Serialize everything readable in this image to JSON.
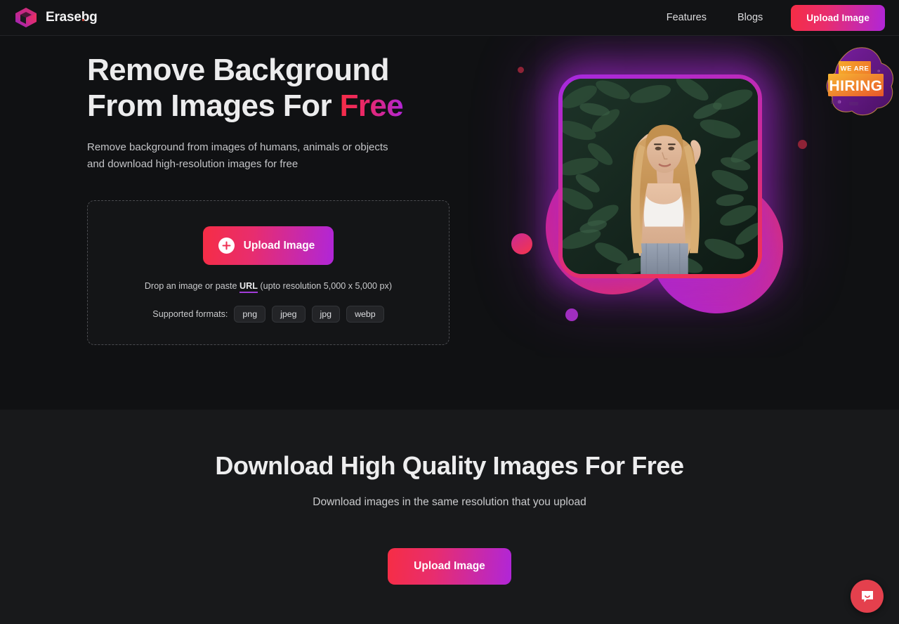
{
  "header": {
    "brand": {
      "name": "Erase",
      "dot": ".",
      "suffix": "bg",
      "icon": "erasebg-cube-logo"
    },
    "nav": [
      {
        "label": "Features",
        "name": "nav-features"
      },
      {
        "label": "Blogs",
        "name": "nav-blogs"
      }
    ],
    "upload_button": "Upload Image"
  },
  "hero": {
    "title_line1": "Remove Background",
    "title_line2_prefix": "From Images For ",
    "title_highlight": "Free",
    "subtitle_line1": "Remove background from images of humans, animals or objects",
    "subtitle_line2": "and download high-resolution images for free",
    "dropzone": {
      "upload_button": "Upload Image",
      "plus_icon": "plus-icon",
      "hint_prefix": "Drop an image or paste ",
      "hint_url": "URL",
      "hint_suffix": " (upto resolution 5,000 x 5,000 px)",
      "formats_label": "Supported formats:",
      "formats": [
        "png",
        "jpeg",
        "jpg",
        "webp"
      ]
    },
    "art": {
      "image_alt": "woman with long wavy blonde hair in white crop top against dark green leaves",
      "badge": {
        "line1": "WE ARE",
        "line2": "HIRING"
      }
    }
  },
  "download_section": {
    "title": "Download High Quality Images For Free",
    "subtitle": "Download images in the same resolution that you upload",
    "button": "Upload Image"
  },
  "chat_widget": {
    "icon": "chat-bubble-smile-icon"
  },
  "colors": {
    "page_bg": "#101113",
    "section_bg": "#18191b",
    "header_bg": "#121315",
    "accent_red": "#f62d45",
    "accent_pink": "#e8276d",
    "accent_purple": "#b026d8",
    "chat_red": "#e4404d",
    "text_primary": "#ececed",
    "text_secondary": "#c9cacc"
  }
}
